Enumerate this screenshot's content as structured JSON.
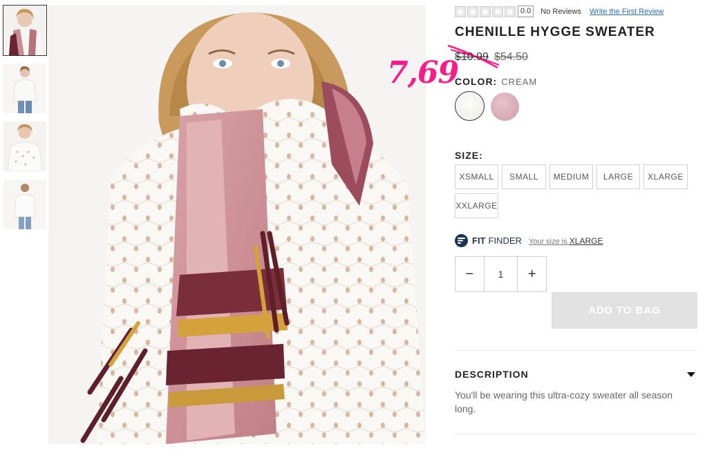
{
  "thumbnails": [
    {
      "label": "",
      "active": true
    },
    {
      "label": "",
      "active": false
    },
    {
      "label": "",
      "active": false
    },
    {
      "label": "",
      "active": false
    }
  ],
  "rating": {
    "value": "0.0",
    "reviews": "No Reviews",
    "write_review": "Write the First Review",
    "stars_filled": 0,
    "stars_total": 5
  },
  "product": {
    "title": "CHENILLE HYGGE SWEATER",
    "sale_price": "$10.99",
    "original_price": "$54.50",
    "overlay_price": "7,69"
  },
  "color": {
    "label": "COLOR:",
    "selected": "CREAM",
    "swatches": [
      {
        "name": "cream",
        "hex": "#f4f3ef"
      },
      {
        "name": "pink",
        "hex": "#d8adb8"
      }
    ]
  },
  "size": {
    "label": "SIZE:",
    "options": [
      "XSMALL",
      "SMALL",
      "MEDIUM",
      "LARGE",
      "XLARGE",
      "XXLARGE"
    ]
  },
  "fit_finder": {
    "fit": "FIT",
    "finder": "FINDER",
    "prompt": "Your size is",
    "size": "XLARGE"
  },
  "quantity": {
    "minus": "−",
    "value": "1",
    "plus": "+"
  },
  "add_to_bag": "ADD TO BAG",
  "description": {
    "title": "DESCRIPTION",
    "text": "You'll be wearing this ultra-cozy sweater all season long."
  },
  "colors": {
    "overlay": "#ff1a8c",
    "fit_finder": "#1b3550",
    "link": "#2a6fb0",
    "button_disabled": "#e2e2e2"
  }
}
